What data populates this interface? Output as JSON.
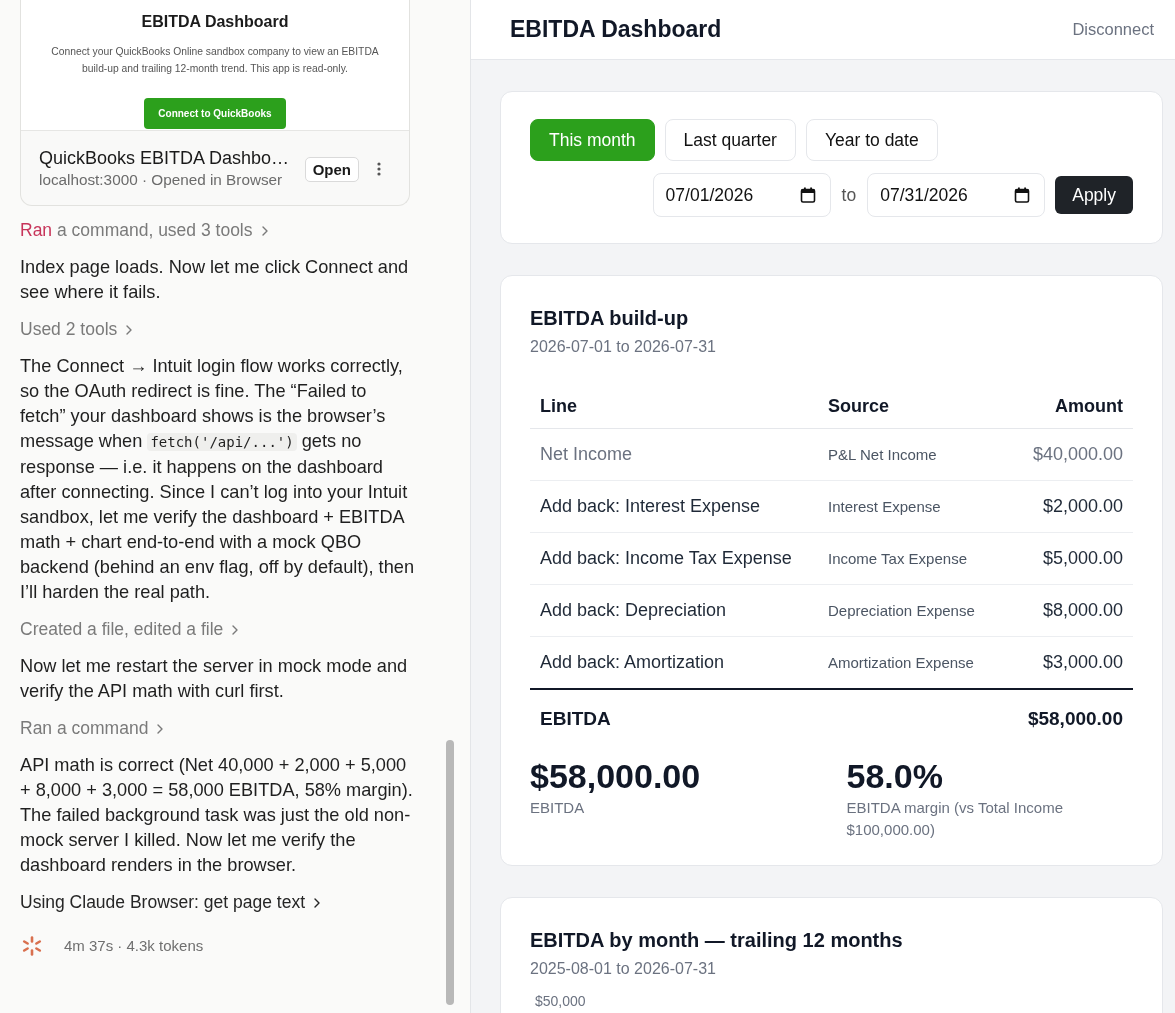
{
  "transcript": {
    "app_card": {
      "preview": {
        "title": "EBITDA Dashboard",
        "description": "Connect your QuickBooks Online sandbox company to view an EBITDA build-up and trailing 12-month trend. This app is read-only.",
        "button": "Connect to QuickBooks"
      },
      "title": "QuickBooks EBITDA Dashbo…",
      "subtitle": "localhost:3000 · Opened in Browser",
      "open_button": "Open"
    },
    "items": [
      {
        "kind": "step",
        "lead": "Ran",
        "text": "a command, used 3 tools"
      },
      {
        "kind": "message",
        "parts": [
          {
            "kind": "text",
            "text": "Index page loads. Now let me click Connect and see where it fails."
          }
        ]
      },
      {
        "kind": "step",
        "text": "Used 2 tools"
      },
      {
        "kind": "message",
        "parts": [
          {
            "kind": "text",
            "text": "The Connect → Intuit login flow works correctly, so the OAuth redirect is fine. The “Failed to fetch” your dashboard shows is the browser’s message when "
          },
          {
            "kind": "code",
            "text": "fetch('/api/...')"
          },
          {
            "kind": "text",
            "text": " gets no response — i.e. it happens on the dashboard after connecting. Since I can’t log into your Intuit sandbox, let me verify the dashboard + EBITDA math + chart end-to-end with a mock QBO backend (behind an env flag, off by default), then I’ll harden the real path."
          }
        ]
      },
      {
        "kind": "step",
        "text": "Created a file, edited a file"
      },
      {
        "kind": "message",
        "parts": [
          {
            "kind": "text",
            "text": "Now let me restart the server in mock mode and verify the API math with curl first."
          }
        ]
      },
      {
        "kind": "step",
        "text": "Ran a command"
      },
      {
        "kind": "message",
        "parts": [
          {
            "kind": "text",
            "text": "API math is correct (Net 40,000 + 2,000 + 5,000 + 8,000 + 3,000 = 58,000 EBITDA, 58% margin). The failed background task was just the old non-mock server I killed. Now let me verify the dashboard renders in the browser."
          }
        ]
      },
      {
        "kind": "tool_use",
        "text": "Using Claude Browser: get page text"
      }
    ],
    "footer": {
      "text": "4m 37s · 4.3k tokens"
    }
  },
  "dashboard": {
    "header": {
      "title": "EBITDA Dashboard",
      "disconnect": "Disconnect"
    },
    "period": {
      "presets": [
        {
          "label": "This month",
          "selected": true
        },
        {
          "label": "Last quarter",
          "selected": false
        },
        {
          "label": "Year to date",
          "selected": false
        }
      ],
      "start_date": "07/01/2026",
      "separator": "to",
      "end_date": "07/31/2026",
      "apply": "Apply"
    },
    "buildup": {
      "title": "EBITDA build-up",
      "range": "2026-07-01 to 2026-07-31",
      "columns": [
        "Line",
        "Source",
        "Amount"
      ],
      "rows": [
        {
          "kind": "base",
          "line": "Net Income",
          "source": "P&L Net Income",
          "amount": "$40,000.00"
        },
        {
          "kind": "addback",
          "line": "Add back: Interest Expense",
          "source": "Interest Expense",
          "amount": "$2,000.00"
        },
        {
          "kind": "addback",
          "line": "Add back: Income Tax Expense",
          "source": "Income Tax Expense",
          "amount": "$5,000.00"
        },
        {
          "kind": "addback",
          "line": "Add back: Depreciation",
          "source": "Depreciation Expense",
          "amount": "$8,000.00"
        },
        {
          "kind": "addback",
          "line": "Add back: Amortization",
          "source": "Amortization Expense",
          "amount": "$3,000.00"
        }
      ],
      "total": {
        "line": "EBITDA",
        "amount": "$58,000.00"
      },
      "metrics": [
        {
          "value": "$58,000.00",
          "label": "EBITDA"
        },
        {
          "value": "58.0%",
          "label": "EBITDA margin (vs Total Income $100,000.00)"
        }
      ]
    },
    "trend": {
      "title": "EBITDA by month — trailing 12 months",
      "range": "2025-08-01 to 2026-07-31",
      "y_axis_label": "$50,000"
    }
  }
}
